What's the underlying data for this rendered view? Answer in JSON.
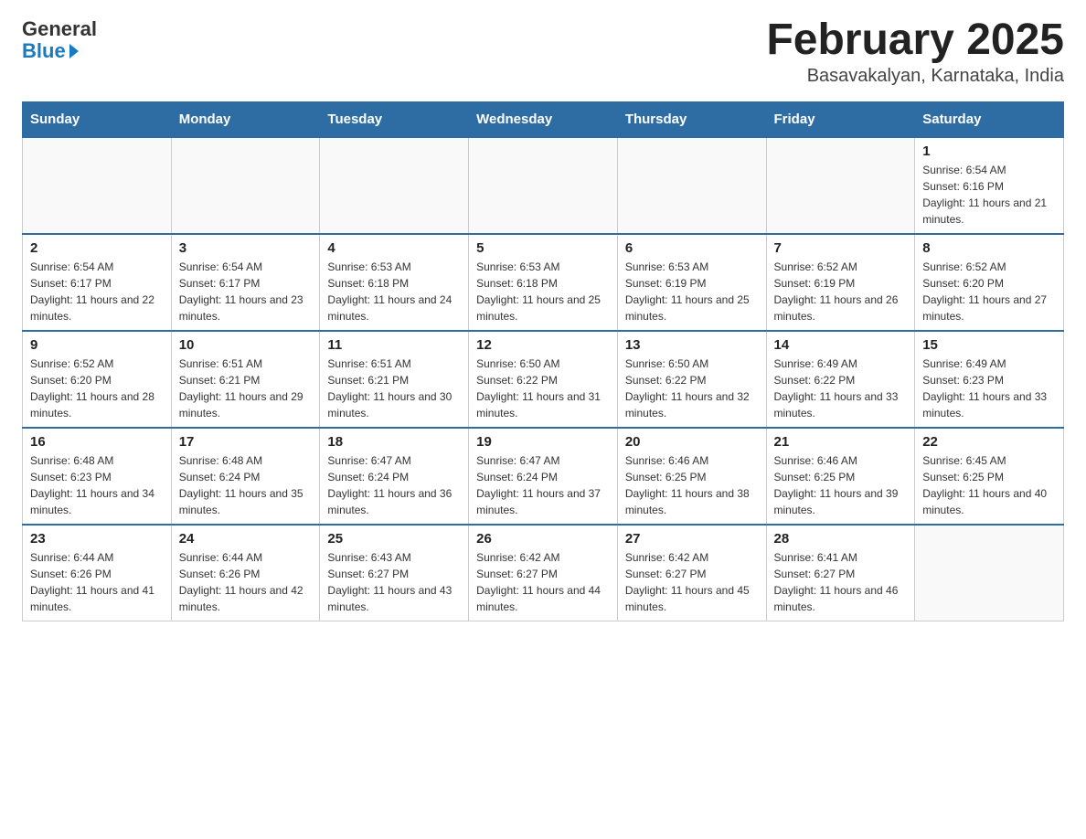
{
  "header": {
    "logo_general": "General",
    "logo_blue": "Blue",
    "month_title": "February 2025",
    "location": "Basavakalyan, Karnataka, India"
  },
  "days_of_week": [
    "Sunday",
    "Monday",
    "Tuesday",
    "Wednesday",
    "Thursday",
    "Friday",
    "Saturday"
  ],
  "weeks": [
    [
      {
        "day": "",
        "info": ""
      },
      {
        "day": "",
        "info": ""
      },
      {
        "day": "",
        "info": ""
      },
      {
        "day": "",
        "info": ""
      },
      {
        "day": "",
        "info": ""
      },
      {
        "day": "",
        "info": ""
      },
      {
        "day": "1",
        "info": "Sunrise: 6:54 AM\nSunset: 6:16 PM\nDaylight: 11 hours and 21 minutes."
      }
    ],
    [
      {
        "day": "2",
        "info": "Sunrise: 6:54 AM\nSunset: 6:17 PM\nDaylight: 11 hours and 22 minutes."
      },
      {
        "day": "3",
        "info": "Sunrise: 6:54 AM\nSunset: 6:17 PM\nDaylight: 11 hours and 23 minutes."
      },
      {
        "day": "4",
        "info": "Sunrise: 6:53 AM\nSunset: 6:18 PM\nDaylight: 11 hours and 24 minutes."
      },
      {
        "day": "5",
        "info": "Sunrise: 6:53 AM\nSunset: 6:18 PM\nDaylight: 11 hours and 25 minutes."
      },
      {
        "day": "6",
        "info": "Sunrise: 6:53 AM\nSunset: 6:19 PM\nDaylight: 11 hours and 25 minutes."
      },
      {
        "day": "7",
        "info": "Sunrise: 6:52 AM\nSunset: 6:19 PM\nDaylight: 11 hours and 26 minutes."
      },
      {
        "day": "8",
        "info": "Sunrise: 6:52 AM\nSunset: 6:20 PM\nDaylight: 11 hours and 27 minutes."
      }
    ],
    [
      {
        "day": "9",
        "info": "Sunrise: 6:52 AM\nSunset: 6:20 PM\nDaylight: 11 hours and 28 minutes."
      },
      {
        "day": "10",
        "info": "Sunrise: 6:51 AM\nSunset: 6:21 PM\nDaylight: 11 hours and 29 minutes."
      },
      {
        "day": "11",
        "info": "Sunrise: 6:51 AM\nSunset: 6:21 PM\nDaylight: 11 hours and 30 minutes."
      },
      {
        "day": "12",
        "info": "Sunrise: 6:50 AM\nSunset: 6:22 PM\nDaylight: 11 hours and 31 minutes."
      },
      {
        "day": "13",
        "info": "Sunrise: 6:50 AM\nSunset: 6:22 PM\nDaylight: 11 hours and 32 minutes."
      },
      {
        "day": "14",
        "info": "Sunrise: 6:49 AM\nSunset: 6:22 PM\nDaylight: 11 hours and 33 minutes."
      },
      {
        "day": "15",
        "info": "Sunrise: 6:49 AM\nSunset: 6:23 PM\nDaylight: 11 hours and 33 minutes."
      }
    ],
    [
      {
        "day": "16",
        "info": "Sunrise: 6:48 AM\nSunset: 6:23 PM\nDaylight: 11 hours and 34 minutes."
      },
      {
        "day": "17",
        "info": "Sunrise: 6:48 AM\nSunset: 6:24 PM\nDaylight: 11 hours and 35 minutes."
      },
      {
        "day": "18",
        "info": "Sunrise: 6:47 AM\nSunset: 6:24 PM\nDaylight: 11 hours and 36 minutes."
      },
      {
        "day": "19",
        "info": "Sunrise: 6:47 AM\nSunset: 6:24 PM\nDaylight: 11 hours and 37 minutes."
      },
      {
        "day": "20",
        "info": "Sunrise: 6:46 AM\nSunset: 6:25 PM\nDaylight: 11 hours and 38 minutes."
      },
      {
        "day": "21",
        "info": "Sunrise: 6:46 AM\nSunset: 6:25 PM\nDaylight: 11 hours and 39 minutes."
      },
      {
        "day": "22",
        "info": "Sunrise: 6:45 AM\nSunset: 6:25 PM\nDaylight: 11 hours and 40 minutes."
      }
    ],
    [
      {
        "day": "23",
        "info": "Sunrise: 6:44 AM\nSunset: 6:26 PM\nDaylight: 11 hours and 41 minutes."
      },
      {
        "day": "24",
        "info": "Sunrise: 6:44 AM\nSunset: 6:26 PM\nDaylight: 11 hours and 42 minutes."
      },
      {
        "day": "25",
        "info": "Sunrise: 6:43 AM\nSunset: 6:27 PM\nDaylight: 11 hours and 43 minutes."
      },
      {
        "day": "26",
        "info": "Sunrise: 6:42 AM\nSunset: 6:27 PM\nDaylight: 11 hours and 44 minutes."
      },
      {
        "day": "27",
        "info": "Sunrise: 6:42 AM\nSunset: 6:27 PM\nDaylight: 11 hours and 45 minutes."
      },
      {
        "day": "28",
        "info": "Sunrise: 6:41 AM\nSunset: 6:27 PM\nDaylight: 11 hours and 46 minutes."
      },
      {
        "day": "",
        "info": ""
      }
    ]
  ]
}
